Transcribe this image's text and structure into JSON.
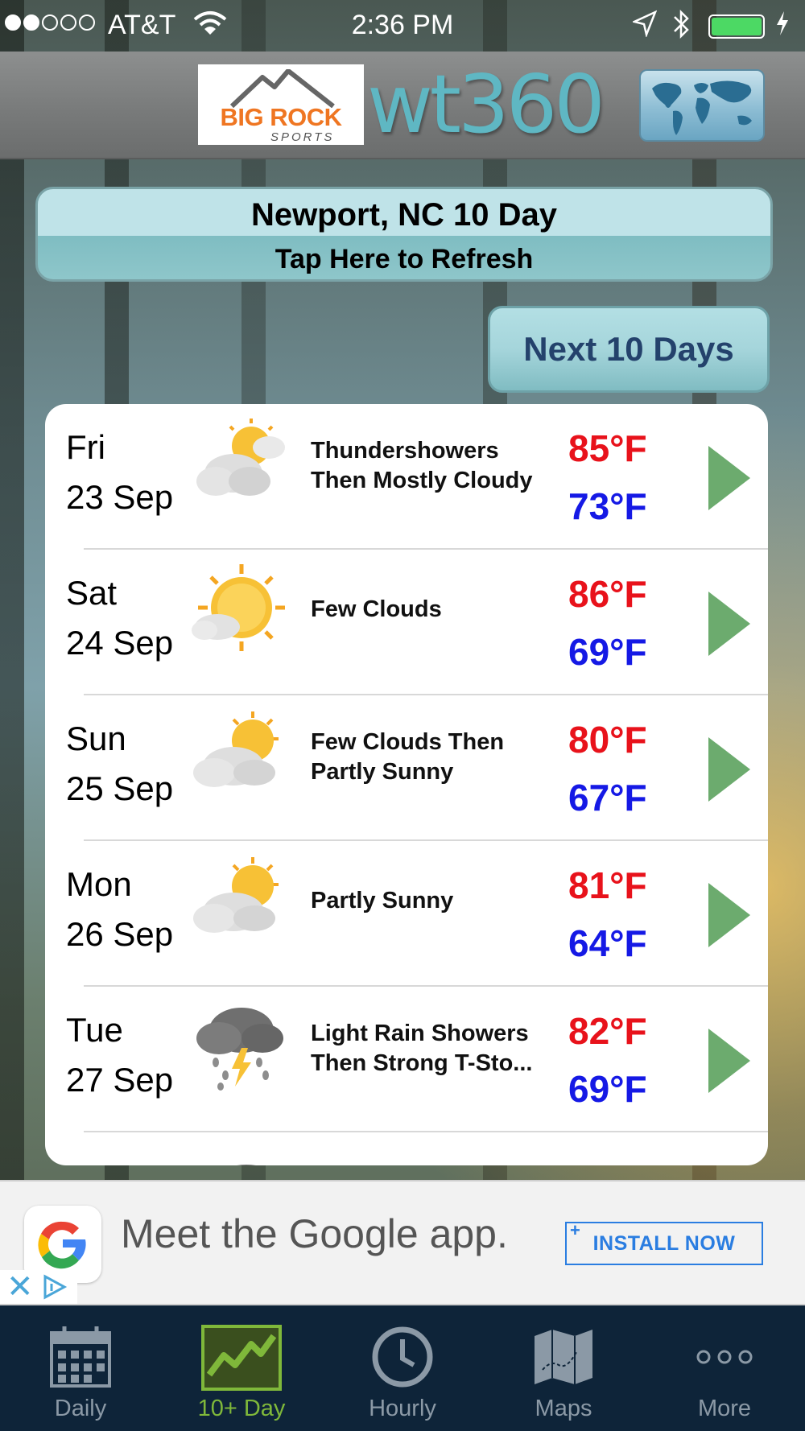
{
  "status_bar": {
    "carrier": "AT&T",
    "time": "2:36 PM",
    "signal_bars_filled": 2,
    "signal_bars_total": 5,
    "battery_level": 1.0,
    "battery_color": "#4cd964"
  },
  "header": {
    "logo_brand_top": "BIG ROCK",
    "logo_brand_bottom": "SPORTS",
    "app_logo": "wt360",
    "map_button_icon": "world-map-icon"
  },
  "location_banner": {
    "title": "Newport, NC 10 Day",
    "subtitle": "Tap Here to Refresh"
  },
  "next_button_label": "Next 10 Days",
  "forecast": [
    {
      "day": "Fri",
      "date": "23 Sep",
      "icon": "sun-cloud-icon",
      "condition_line1": "Thundershowers",
      "condition_line2": "Then Mostly Cloudy",
      "high": "85°F",
      "low": "73°F"
    },
    {
      "day": "Sat",
      "date": "24 Sep",
      "icon": "sun-small-cloud-icon",
      "condition_line1": "Few Clouds",
      "condition_line2": "",
      "high": "86°F",
      "low": "69°F"
    },
    {
      "day": "Sun",
      "date": "25 Sep",
      "icon": "partly-sunny-icon",
      "condition_line1": "Few Clouds Then",
      "condition_line2": "Partly Sunny",
      "high": "80°F",
      "low": "67°F"
    },
    {
      "day": "Mon",
      "date": "26 Sep",
      "icon": "partly-sunny-icon",
      "condition_line1": "Partly Sunny",
      "condition_line2": "",
      "high": "81°F",
      "low": "64°F"
    },
    {
      "day": "Tue",
      "date": "27 Sep",
      "icon": "thunderstorm-rain-icon",
      "condition_line1": "Light Rain Showers",
      "condition_line2": "Then Strong T-Sto...",
      "high": "82°F",
      "low": "69°F"
    }
  ],
  "ad": {
    "text": "Meet the Google app.",
    "button": "INSTALL NOW",
    "close_symbol": "✕",
    "brand_icon": "google-g-icon",
    "accent": "#2a7de1"
  },
  "tabs": [
    {
      "label": "Daily",
      "icon": "calendar-icon",
      "active": false
    },
    {
      "label": "10+ Day",
      "icon": "trend-chart-icon",
      "active": true
    },
    {
      "label": "Hourly",
      "icon": "clock-icon",
      "active": false
    },
    {
      "label": "Maps",
      "icon": "map-icon",
      "active": false
    },
    {
      "label": "More",
      "icon": "more-dots-icon",
      "active": false
    }
  ],
  "colors": {
    "high_temp": "#e8121b",
    "low_temp": "#1519e5",
    "active_tab": "#7fb83a",
    "tab_bar": "#0e2439"
  }
}
